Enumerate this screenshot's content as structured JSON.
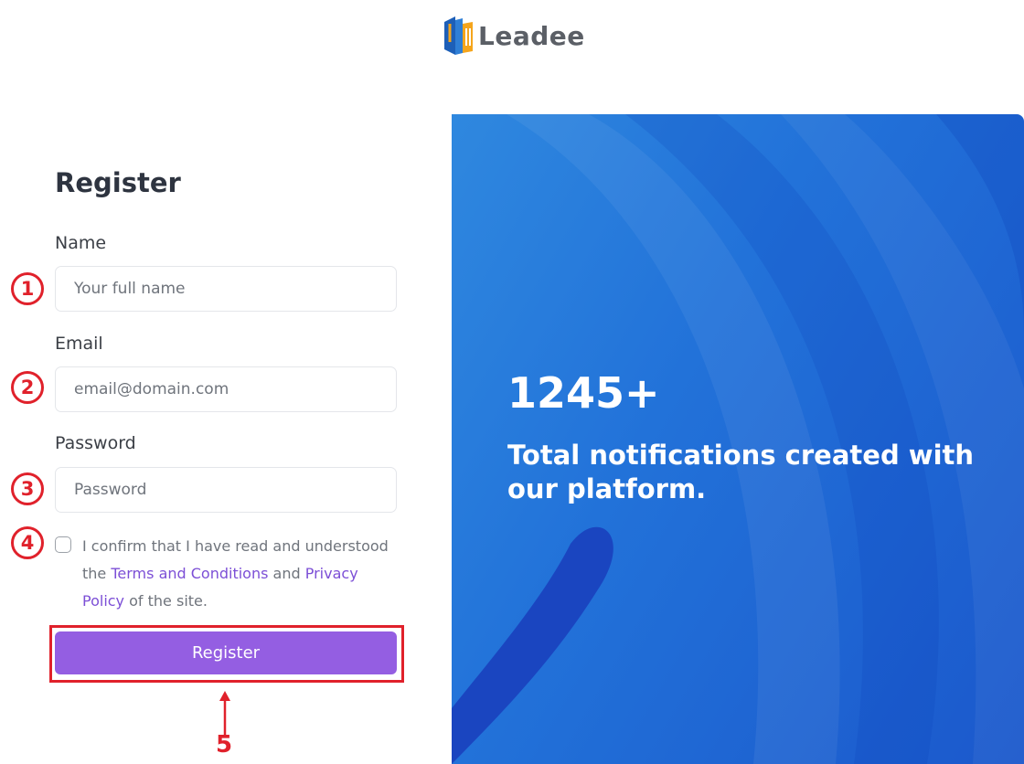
{
  "brand": {
    "name": "Leadee",
    "colors": {
      "primary": "#945ee2",
      "link": "#7c4fd6",
      "hero": "#2272d9",
      "annotation": "#e0212b"
    }
  },
  "form": {
    "title": "Register",
    "name": {
      "label": "Name",
      "placeholder": "Your full name",
      "value": ""
    },
    "email": {
      "label": "Email",
      "placeholder": "email@domain.com",
      "value": ""
    },
    "password": {
      "label": "Password",
      "placeholder": "Password",
      "value": ""
    },
    "terms": {
      "checked": false,
      "text_before": "I confirm that I have read and understood the",
      "terms_link": "Terms and Conditions",
      "conjunction": "and",
      "privacy_link": "Privacy Policy",
      "text_after": "of the site."
    },
    "submit_label": "Register"
  },
  "annotations": {
    "steps": [
      "1",
      "2",
      "3",
      "4"
    ],
    "submit_step": "5"
  },
  "hero": {
    "stat": "1245+",
    "caption": "Total notifications created with our platform."
  }
}
